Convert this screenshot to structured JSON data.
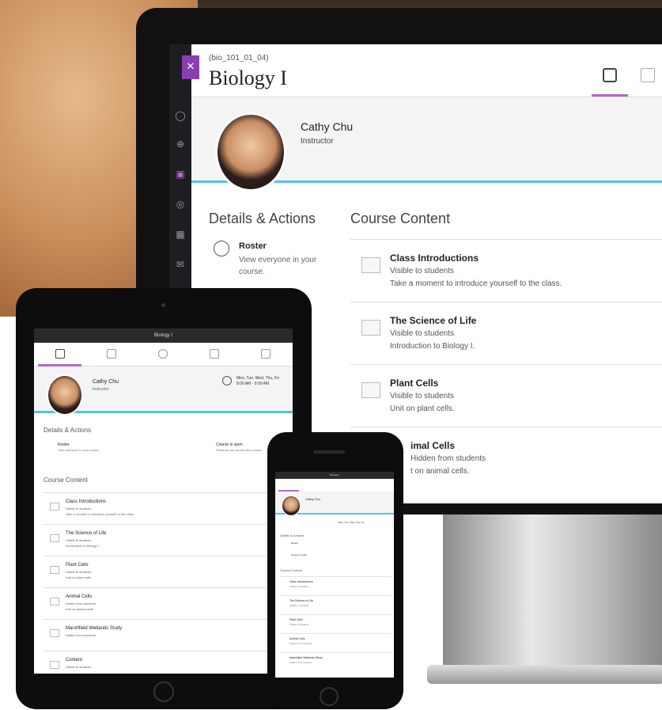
{
  "monitor": {
    "course_code": "(bio_101_01_04)",
    "course_title": "Biology I",
    "instructor": {
      "name": "Cathy Chu",
      "role": "Instructor"
    },
    "details_heading": "Details & Actions",
    "roster": {
      "title": "Roster",
      "desc": "View everyone in your course."
    },
    "content_heading": "Course Content",
    "items": [
      {
        "title": "Class Introductions",
        "visibility": "Visible to students",
        "desc": "Take a moment to introduce yourself to the class."
      },
      {
        "title": "The Science of Life",
        "visibility": "Visible to students",
        "desc": "Introduction to Biology I."
      },
      {
        "title": "Plant Cells",
        "visibility": "Visible to students",
        "desc": "Unit on plant cells."
      },
      {
        "title": "imal Cells",
        "visibility": "Hidden from students",
        "desc": "t on animal cells."
      }
    ],
    "accent_color": "#b26ad0",
    "banner_line_color": "#55c3e8"
  },
  "tablet": {
    "title": "Biology I",
    "instructor": {
      "name": "Cathy Chu",
      "role": "Instructor"
    },
    "schedule": "Mon, Tue, Wed, Thu, Fri 8:00 AM - 9:00 AM",
    "details_heading": "Details & Actions",
    "roster": {
      "title": "Roster",
      "desc": "View everyone in your course."
    },
    "course_open": {
      "title": "Course is open",
      "desc": "Students can access this course."
    },
    "content_heading": "Course Content",
    "items": [
      {
        "title": "Class Introductions",
        "visibility": "Visible to students",
        "desc": "Take a moment to introduce yourself to the class."
      },
      {
        "title": "The Science of Life",
        "visibility": "Visible to students",
        "desc": "Introduction to Biology I."
      },
      {
        "title": "Plant Cells",
        "visibility": "Visible to students",
        "desc": "Unit on plant cells."
      },
      {
        "title": "Animal Cells",
        "visibility": "Hidden from students",
        "desc": "Unit on animal cells."
      },
      {
        "title": "Marshfield Wetlands Study",
        "visibility": "Hidden from students",
        "desc": ""
      },
      {
        "title": "Content",
        "visibility": "Visible to students",
        "desc": ""
      }
    ]
  },
  "phone": {
    "title": "Biology I",
    "instructor": {
      "name": "Cathy Chu"
    },
    "schedule": "Mon, Tue, Wed, Thu, Fri",
    "details_heading": "Details & Actions",
    "roster_title": "Roster",
    "open_title": "Course is open",
    "content_heading": "Course Content",
    "items": [
      {
        "title": "Class Introductions",
        "visibility": "Visible to students"
      },
      {
        "title": "The Science of Life",
        "visibility": "Visible to students"
      },
      {
        "title": "Plant Cells",
        "visibility": "Visible to students"
      },
      {
        "title": "Animal Cells",
        "visibility": "Hidden from students"
      },
      {
        "title": "Marshfield Wetlands Study",
        "visibility": "Hidden from students"
      }
    ]
  }
}
